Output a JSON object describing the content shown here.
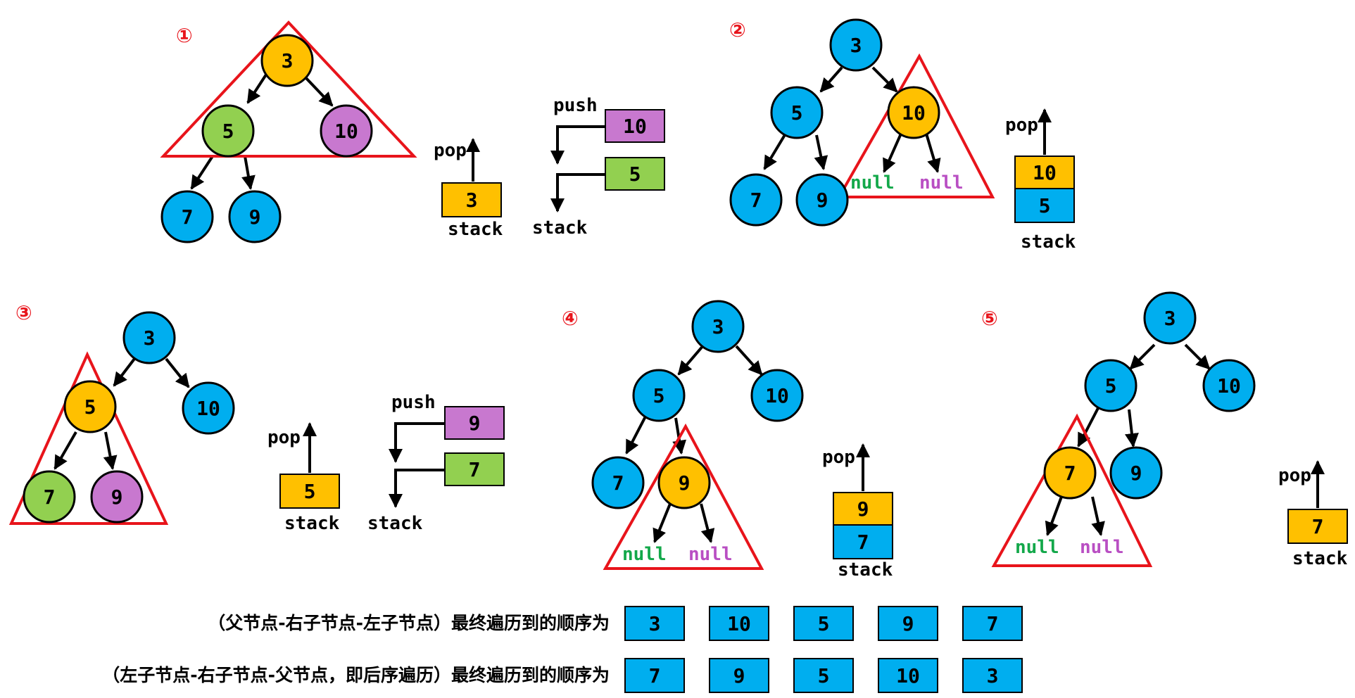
{
  "colors": {
    "blue": "#00aeef",
    "orange": "#ffc000",
    "green": "#92d050",
    "purple": "#c878cf",
    "red": "#e8141b",
    "null_green": "#13a84a",
    "null_purple": "#b94fc3"
  },
  "labels": {
    "push": "push",
    "pop": "pop",
    "stack": "stack",
    "null": "null"
  },
  "steps": {
    "s1": "①",
    "s2": "②",
    "s3": "③",
    "s4": "④",
    "s5": "⑤"
  },
  "tree": {
    "root": "3",
    "left": "5",
    "right": "10",
    "left_left": "7",
    "left_right": "9"
  },
  "panel1": {
    "stack_items": [
      "3"
    ],
    "push_items": [
      "10",
      "5"
    ]
  },
  "panel2": {
    "stack_items": [
      "10",
      "5"
    ]
  },
  "panel3": {
    "stack_items": [
      "5"
    ],
    "push_items": [
      "9",
      "7"
    ]
  },
  "panel4": {
    "stack_items": [
      "9",
      "7"
    ]
  },
  "panel5": {
    "stack_items": [
      "7"
    ]
  },
  "results": [
    {
      "caption": "（父节点-右子节点-左子节点）最终遍历到的顺序为",
      "values": [
        "3",
        "10",
        "5",
        "9",
        "7"
      ]
    },
    {
      "caption": "（左子节点-右子节点-父节点，即后序遍历）最终遍历到的顺序为",
      "values": [
        "7",
        "9",
        "5",
        "10",
        "3"
      ]
    }
  ]
}
